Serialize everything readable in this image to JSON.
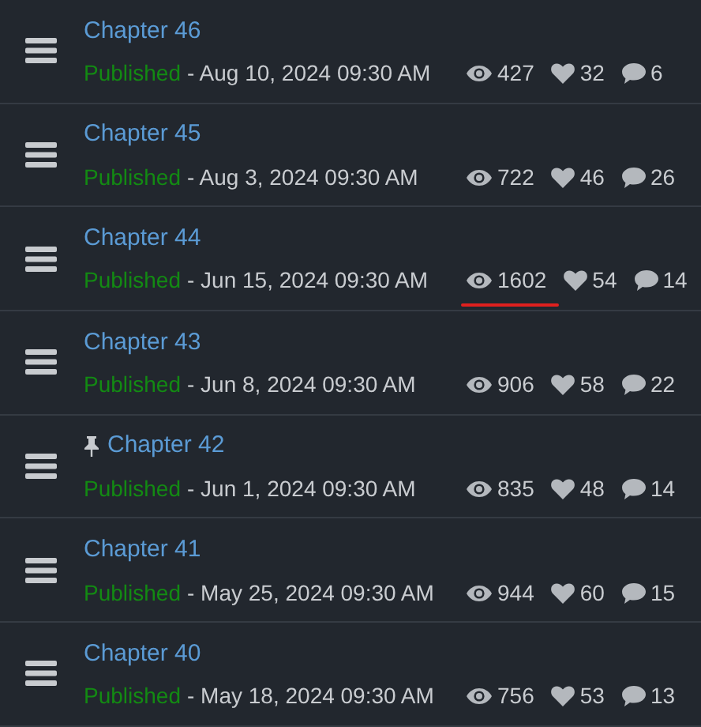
{
  "chapters": [
    {
      "title": "Chapter 46",
      "pinned": false,
      "status": "Published",
      "date": "- Aug 10, 2024 09:30 AM",
      "views": "427",
      "likes": "32",
      "comments": "6",
      "views_underlined": false
    },
    {
      "title": "Chapter 45",
      "pinned": false,
      "status": "Published",
      "date": "- Aug 3, 2024 09:30 AM",
      "views": "722",
      "likes": "46",
      "comments": "26",
      "views_underlined": false
    },
    {
      "title": "Chapter 44",
      "pinned": false,
      "status": "Published",
      "date": "- Jun 15, 2024 09:30 AM",
      "views": "1602",
      "likes": "54",
      "comments": "14",
      "views_underlined": true
    },
    {
      "title": "Chapter 43",
      "pinned": false,
      "status": "Published",
      "date": "- Jun 8, 2024 09:30 AM",
      "views": "906",
      "likes": "58",
      "comments": "22",
      "views_underlined": false
    },
    {
      "title": "Chapter 42",
      "pinned": true,
      "status": "Published",
      "date": "- Jun 1, 2024 09:30 AM",
      "views": "835",
      "likes": "48",
      "comments": "14",
      "views_underlined": false
    },
    {
      "title": "Chapter 41",
      "pinned": false,
      "status": "Published",
      "date": "- May 25, 2024 09:30 AM",
      "views": "944",
      "likes": "60",
      "comments": "15",
      "views_underlined": false
    },
    {
      "title": "Chapter 40",
      "pinned": false,
      "status": "Published",
      "date": "- May 18, 2024 09:30 AM",
      "views": "756",
      "likes": "53",
      "comments": "13",
      "views_underlined": false
    }
  ]
}
